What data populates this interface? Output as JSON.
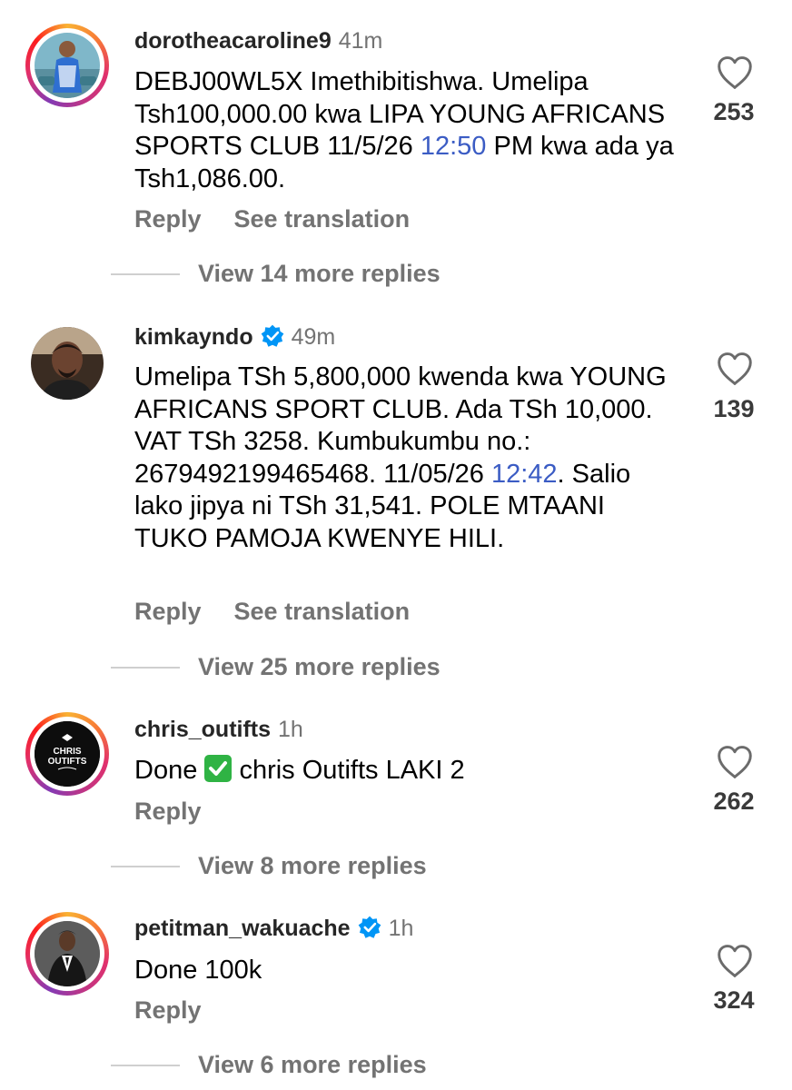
{
  "comments": [
    {
      "username": "dorotheacaroline9",
      "time": "41m",
      "verified": false,
      "text_parts": [
        "DEBJ00WL5X Imethibitishwa. Umelipa Tsh100,000.00 kwa LIPA YOUNG AFRICANS SPORTS CLUB 11/5/26 ",
        "12:50",
        " PM kwa ada ya Tsh1,086.00."
      ],
      "reply_label": "Reply",
      "translate_label": "See translation",
      "likes": "253",
      "view_replies": "View 14 more replies"
    },
    {
      "username": "kimkayndo",
      "time": "49m",
      "verified": true,
      "text_parts": [
        "Umelipa TSh 5,800,000 kwenda kwa YOUNG AFRICANS SPORT CLUB. Ada TSh 10,000. VAT TSh 3258. Kumbukumbu no.: 2679492199465468. 11/05/26 ",
        "12:42",
        ". Salio lako jipya ni TSh 31,541. POLE MTAANI TUKO PAMOJA KWENYE HILI."
      ],
      "reply_label": "Reply",
      "translate_label": "See translation",
      "likes": "139",
      "view_replies": "View 25 more replies"
    },
    {
      "username": "chris_outifts",
      "time": "1h",
      "verified": false,
      "text_parts": [
        "Done ",
        "✅",
        " chris Outifts LAKI 2"
      ],
      "reply_label": "Reply",
      "likes": "262",
      "view_replies": "View 8 more replies",
      "avatar_logo": [
        "CHRIS",
        "OUTIFTS"
      ]
    },
    {
      "username": "petitman_wakuache",
      "time": "1h",
      "verified": true,
      "text_parts": [
        "Done 100k"
      ],
      "reply_label": "Reply",
      "likes": "324",
      "view_replies": "View 6 more replies"
    }
  ],
  "icons": {
    "like": "heart-outline-icon",
    "verified": "verified-badge-icon",
    "check": "check-mark-emoji-icon"
  },
  "colors": {
    "timestamp_link": "#3b5cc4",
    "verified_blue": "#0095f6",
    "secondary_text": "#737373",
    "check_green": "#2fb344"
  }
}
